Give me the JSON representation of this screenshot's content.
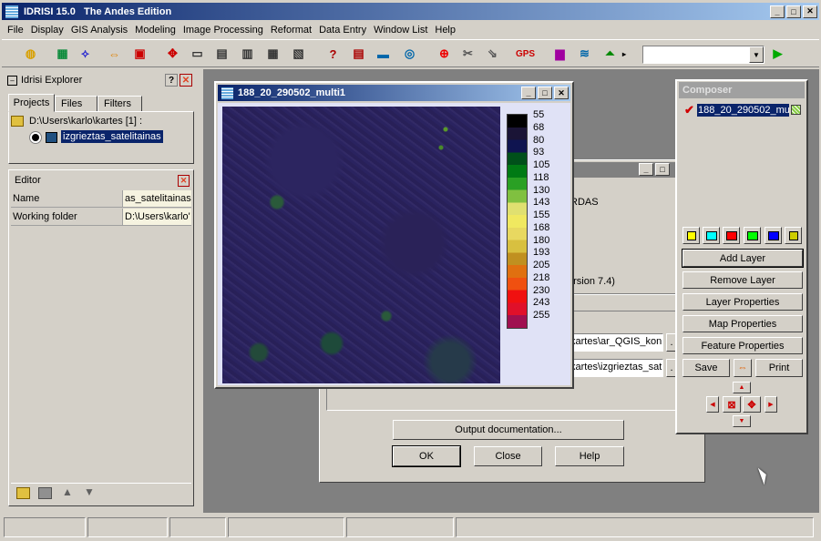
{
  "app": {
    "title": "IDRISI 15.0   The Andes Edition"
  },
  "menu": [
    "File",
    "Display",
    "GIS Analysis",
    "Modeling",
    "Image Processing",
    "Reformat",
    "Data Entry",
    "Window List",
    "Help"
  ],
  "toolbar": {
    "gps": "GPS",
    "combo_value": ""
  },
  "explorer": {
    "title": "Idrisi Explorer",
    "tabs": [
      "Projects",
      "Files",
      "Filters"
    ],
    "project_path": "D:\\Users\\karlo\\kartes [1] :",
    "project_item": "izgrieztas_satelitainas",
    "editor_title": "Editor",
    "editor_rows": [
      {
        "key": "Name",
        "value": "as_satelitainas"
      },
      {
        "key": "Working folder",
        "value": "D:\\Users\\karlo'"
      }
    ]
  },
  "map_window": {
    "title": "188_20_290502_multi1",
    "legend": [
      {
        "label": "55",
        "color": "#000000"
      },
      {
        "label": "68",
        "color": "#1a1436"
      },
      {
        "label": "80",
        "color": "#0f1450"
      },
      {
        "label": "93",
        "color": "#00501a"
      },
      {
        "label": "105",
        "color": "#007a14"
      },
      {
        "label": "118",
        "color": "#2aa024"
      },
      {
        "label": "130",
        "color": "#80c040"
      },
      {
        "label": "143",
        "color": "#e0e070"
      },
      {
        "label": "155",
        "color": "#f0e860"
      },
      {
        "label": "168",
        "color": "#e8d860"
      },
      {
        "label": "180",
        "color": "#d8c040"
      },
      {
        "label": "193",
        "color": "#c09020"
      },
      {
        "label": "205",
        "color": "#e07010"
      },
      {
        "label": "218",
        "color": "#f05010"
      },
      {
        "label": "230",
        "color": "#f01010"
      },
      {
        "label": "243",
        "color": "#e0102a"
      },
      {
        "label": "255",
        "color": "#a01050"
      }
    ]
  },
  "dialog": {
    "text_rdas": "RDAS",
    "text_version": "ersion 7.4)",
    "field1": "kartes\\ar_QGIS_kon",
    "field2": "kartes\\izgrieztas_sat",
    "output_doc": "Output documentation...",
    "ok": "OK",
    "close": "Close",
    "help": "Help"
  },
  "composer": {
    "title": "Composer",
    "layer": "188_20_290502_mul",
    "colors": [
      "#00ffff",
      "#ff0000",
      "#00ff00",
      "#0000ff"
    ],
    "buttons": [
      "Add Layer",
      "Remove Layer",
      "Layer Properties",
      "Map Properties",
      "Feature Properties"
    ],
    "save": "Save",
    "print": "Print"
  }
}
